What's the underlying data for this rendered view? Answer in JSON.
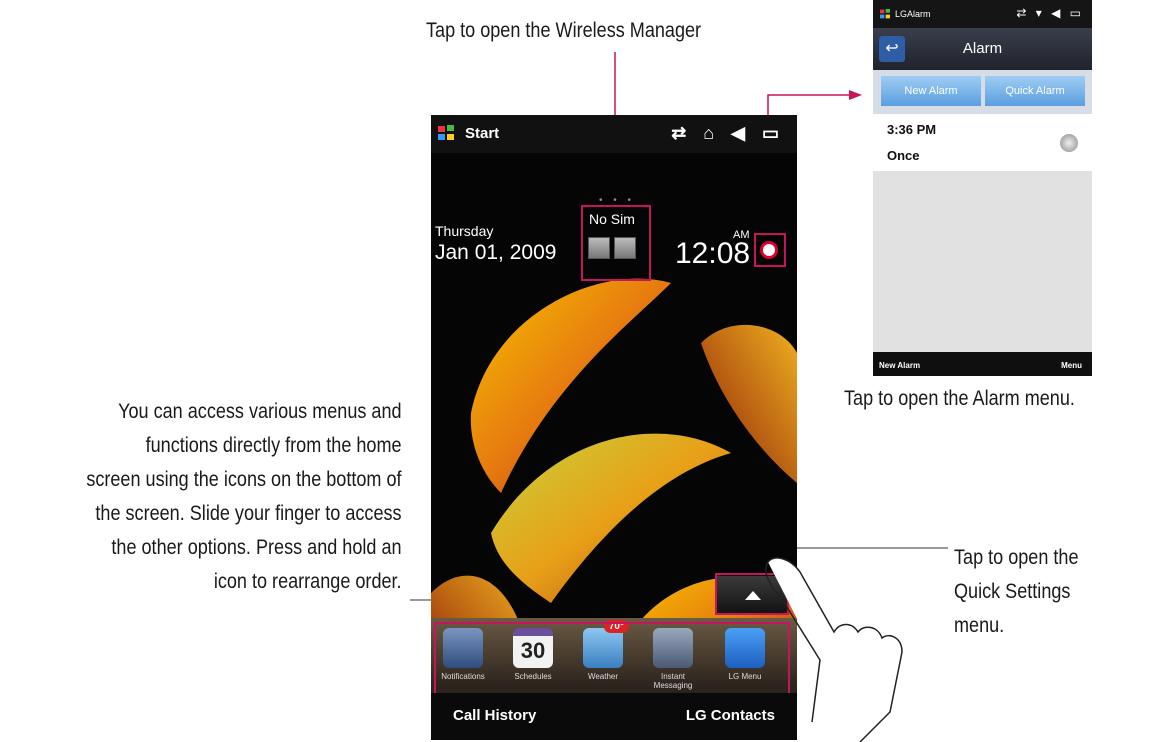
{
  "callouts": {
    "wireless": "Tap to open the Wireless Manager",
    "alarm": "Tap to open the Alarm menu.",
    "quick_settings_lines": [
      "Tap to open the",
      "Quick Settings",
      "menu."
    ],
    "home_lines": [
      "You can access various menus and",
      "functions directly from the home",
      "screen using the icons on the bottom of",
      "the screen. Slide your finger to access",
      "the other options. Press and hold an",
      "icon to rearrange order."
    ]
  },
  "phone": {
    "status": {
      "start_label": "Start",
      "icons": "⇄ ⌂ ◀ ▭"
    },
    "home": {
      "day": "Thursday",
      "date": "Jan 01, 2009",
      "sim": "No Sim",
      "ampm": "AM",
      "time": "12:08"
    },
    "dock": [
      {
        "label": "Notifications",
        "icon": "notifications-icon",
        "color": "#4a6fa5"
      },
      {
        "label": "Schedules",
        "icon": "calendar-icon",
        "color": "#f2f2f2",
        "badge": "30"
      },
      {
        "label": "Weather",
        "icon": "weather-icon",
        "color": "#5aa0d8",
        "badge": "70°"
      },
      {
        "label": "Instant Messaging",
        "icon": "messaging-icon",
        "color": "#6a7d99"
      },
      {
        "label": "LG Menu",
        "icon": "menu-grid-icon",
        "color": "#2f7fe0"
      }
    ],
    "softkeys": {
      "left": "Call History",
      "right": "LG Contacts"
    }
  },
  "alarm_screen": {
    "status_title": "LGAlarm",
    "status_icons": "⇄ ▾ ◀ ▭",
    "header_title": "Alarm",
    "buttons": [
      "New Alarm",
      "Quick Alarm"
    ],
    "alarm_time": "3:36 PM",
    "alarm_frequency": "Once",
    "softkeys": {
      "left": "New Alarm",
      "right": "Menu"
    }
  },
  "colors": {
    "highlight": "#c8145a"
  }
}
